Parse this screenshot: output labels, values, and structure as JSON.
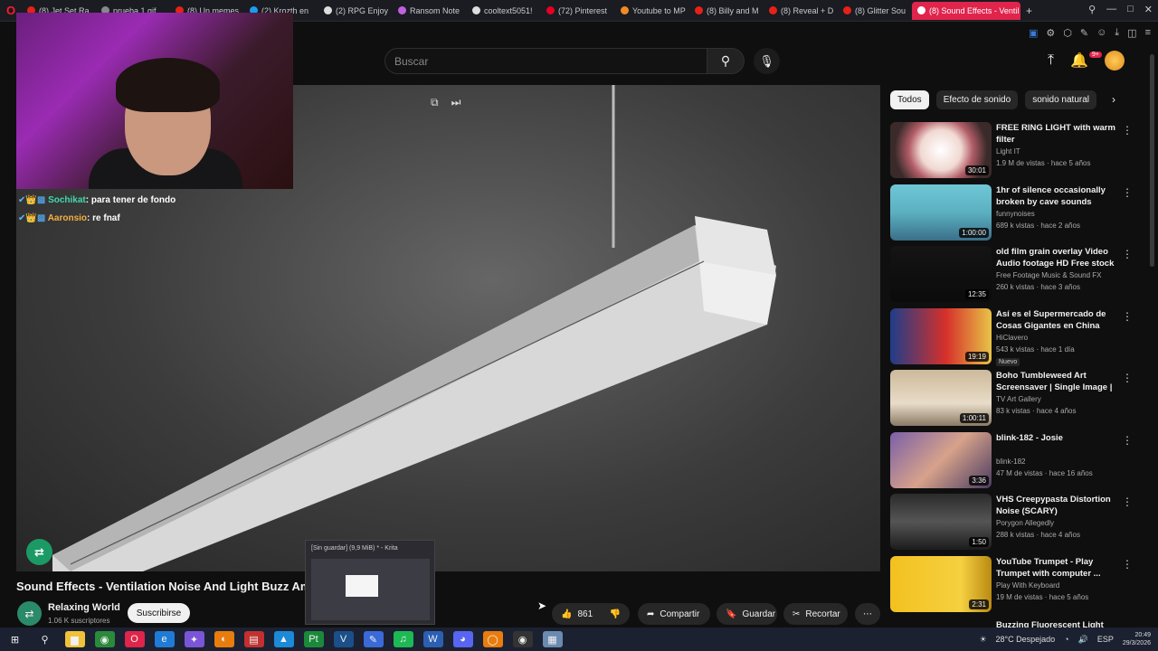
{
  "browser": {
    "tabs": [
      {
        "label": "(8) Jet Set Ra",
        "color": "#e62117"
      },
      {
        "label": "prueba 1.gif",
        "color": "#888888"
      },
      {
        "label": "(8) Un memes",
        "color": "#e62117"
      },
      {
        "label": "(2) Krozth en",
        "color": "#1d9bf0"
      },
      {
        "label": "(2) RPG Enjoy",
        "color": "#dddddd"
      },
      {
        "label": "Ransom Note",
        "color": "#c060e0"
      },
      {
        "label": "cooltext5051!",
        "color": "#dddddd"
      },
      {
        "label": "(72) Pinterest",
        "color": "#e60023"
      },
      {
        "label": "Youtube to MP",
        "color": "#f08a24"
      },
      {
        "label": "(8) Billy and M",
        "color": "#e62117"
      },
      {
        "label": "(8) Reveal + D",
        "color": "#e62117"
      },
      {
        "label": "(8) Glitter Sou",
        "color": "#e62117"
      }
    ],
    "active_tab": "(8) Sound Effects - Ventil",
    "new_tab": "+"
  },
  "header": {
    "search_placeholder": "Buscar",
    "notification_count": "9+"
  },
  "chat": [
    {
      "user": "Sochikat",
      "message": "para tener de fondo"
    },
    {
      "user": "Aaronsio",
      "message": "re fnaf"
    }
  ],
  "video": {
    "title": "Sound Effects - Ventilation Noise And Light Buzz Amb",
    "channel": "Relaxing World",
    "subscribers": "1.06 K suscriptores",
    "subscribe_label": "Suscribirse",
    "likes": "861",
    "share_label": "Compartir",
    "save_label": "Guardar",
    "clip_label": "Recortar"
  },
  "taskbar_preview": {
    "title": "[Sin guardar] (9,9 MiB) * - Krita"
  },
  "chips": [
    "Todos",
    "Efecto de sonido",
    "sonido natural"
  ],
  "recommendations": [
    {
      "title": "FREE RING LIGHT with warm filter",
      "channel": "Light IT",
      "meta": "1.9 M de vistas · hace 5 años",
      "duration": "30:01",
      "badge": "",
      "thumb": "radial-gradient(circle, #ffffff 0%, #f1d9d2 35%, #b25d67 55%, #3a2a2a 80%)"
    },
    {
      "title": "1hr of silence occasionally broken by cave sounds",
      "channel": "funnynoises",
      "meta": "689 k vistas · hace 2 años",
      "duration": "1:00:00",
      "badge": "",
      "thumb": "linear-gradient(180deg, #6fc7d6 0%, #5bb0c0 50%, #3b6f89 100%)"
    },
    {
      "title": "old film grain overlay Video Audio footage HD Free stock ...",
      "channel": "Free Footage Music & Sound FX",
      "meta": "260 k vistas · hace 3 años",
      "duration": "12:35",
      "badge": "",
      "thumb": "linear-gradient(180deg, #141414, #0b0b0b)"
    },
    {
      "title": "Así es el Supermercado de Cosas Gigantes en China",
      "channel": "HiClavero",
      "meta": "543 k vistas · hace 1 día",
      "duration": "19:19",
      "badge": "Nuevo",
      "thumb": "linear-gradient(90deg, #1f3d8a 0%, #d6302a 55%, #e8c347 100%)"
    },
    {
      "title": "Boho Tumbleweed Art Screensaver | Single Image | ...",
      "channel": "TV Art Gallery",
      "meta": "83 k vistas · hace 4 años",
      "duration": "1:00:11",
      "badge": "",
      "thumb": "linear-gradient(180deg, #cdb99a 0%, #e8dcc8 60%, #8a7a65 100%)"
    },
    {
      "title": "blink-182 - Josie",
      "channel": "blink-182",
      "meta": "47 M de vistas · hace 16 años",
      "duration": "3:36",
      "badge": "",
      "thumb": "linear-gradient(135deg, #7a5fa8 0%, #d7a28a 50%, #4a3b62 100%)"
    },
    {
      "title": "VHS Creepypasta Distortion Noise (SCARY)",
      "channel": "Porygon Allegedly",
      "meta": "288 k vistas · hace 4 años",
      "duration": "1:50",
      "badge": "",
      "thumb": "linear-gradient(180deg, #2b2b2b, #555555, #1c1c1c)"
    },
    {
      "title": "YouTube Trumpet - Play Trumpet with computer ...",
      "channel": "Play With Keyboard",
      "meta": "19 M de vistas · hace 5 años",
      "duration": "2:31",
      "badge": "",
      "thumb": "linear-gradient(90deg, #f3c11f 0%, #f5d040 70%, #b98a12 100%)"
    }
  ],
  "partial_recommendation": "Buzzing Fluorescent Light",
  "taskbar": {
    "weather": "28°C Despejado",
    "language": "ESP",
    "time": "20:49",
    "date": "29/3/2026",
    "apps": [
      {
        "name": "windows-start-icon",
        "glyph": "⊞",
        "bg": "transparent"
      },
      {
        "name": "search-icon",
        "glyph": "⚲",
        "bg": "transparent"
      },
      {
        "name": "file-explorer-icon",
        "glyph": "▆",
        "bg": "#f0c23b"
      },
      {
        "name": "chrome-icon",
        "glyph": "◉",
        "bg": "#2a8a3a"
      },
      {
        "name": "opera-icon",
        "glyph": "O",
        "bg": "#e0244b"
      },
      {
        "name": "edge-icon",
        "glyph": "e",
        "bg": "#1f7bd6"
      },
      {
        "name": "app-icon",
        "glyph": "✦",
        "bg": "#7a55d8"
      },
      {
        "name": "blender-icon",
        "glyph": "◐",
        "bg": "#e87d0d"
      },
      {
        "name": "app2-icon",
        "glyph": "▤",
        "bg": "#c23030"
      },
      {
        "name": "photos-icon",
        "glyph": "▲",
        "bg": "#1b8ad8"
      },
      {
        "name": "pycharm-icon",
        "glyph": "Pt",
        "bg": "#1a8a3a"
      },
      {
        "name": "visual-studio-icon",
        "glyph": "V",
        "bg": "#1a4f8a"
      },
      {
        "name": "krita-icon",
        "glyph": "✎",
        "bg": "#3a6ad8"
      },
      {
        "name": "spotify-icon",
        "glyph": "♫",
        "bg": "#1db954"
      },
      {
        "name": "word-icon",
        "glyph": "W",
        "bg": "#2b5fb4"
      },
      {
        "name": "discord-icon",
        "glyph": "◕",
        "bg": "#5865f2"
      },
      {
        "name": "app3-icon",
        "glyph": "◯",
        "bg": "#e87d0d"
      },
      {
        "name": "obs-icon",
        "glyph": "◉",
        "bg": "#333333"
      },
      {
        "name": "notepad-icon",
        "glyph": "▦",
        "bg": "#6a8ab0"
      }
    ]
  }
}
